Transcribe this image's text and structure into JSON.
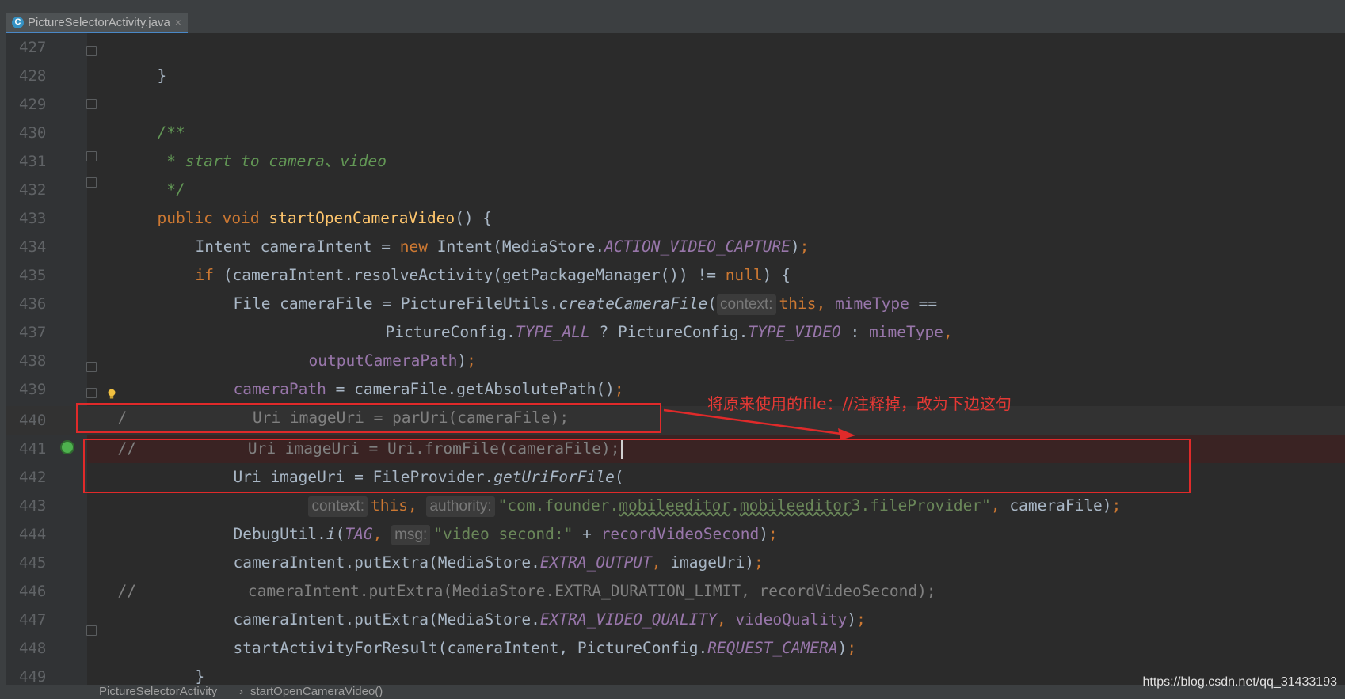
{
  "tab": {
    "icon": "class-c-icon",
    "label": "PictureSelectorActivity.java",
    "close": "×"
  },
  "annotation": {
    "text": "将原来使用的file：//注释掉，改为下边这句"
  },
  "breadcrumb": {
    "class_name": "PictureSelectorActivity",
    "separator": "›",
    "method_name": "startOpenCameraVideo()"
  },
  "watermark": "https://blog.csdn.net/qq_31433193",
  "lines": [
    {
      "num": "427"
    },
    {
      "num": "428"
    },
    {
      "num": "429"
    },
    {
      "num": "430"
    },
    {
      "num": "431"
    },
    {
      "num": "432"
    },
    {
      "num": "433"
    },
    {
      "num": "434"
    },
    {
      "num": "435"
    },
    {
      "num": "436"
    },
    {
      "num": "437"
    },
    {
      "num": "438"
    },
    {
      "num": "439"
    },
    {
      "num": "440"
    },
    {
      "num": "441"
    },
    {
      "num": "442"
    },
    {
      "num": "443"
    },
    {
      "num": "444"
    },
    {
      "num": "445"
    },
    {
      "num": "446"
    },
    {
      "num": "447"
    },
    {
      "num": "448"
    },
    {
      "num": "449"
    }
  ],
  "code": {
    "l427": "}",
    "l429": "/**",
    "l430": " * start to camera、video",
    "l431": " */",
    "l432_kw": "public void ",
    "l432_fn": "startOpenCameraVideo",
    "l432_rest": "() {",
    "l433_a": "Intent cameraIntent = ",
    "l433_kw": "new ",
    "l433_b": "Intent(MediaStore.",
    "l433_st": "ACTION_VIDEO_CAPTURE",
    "l433_c": ")",
    "l433_semi": ";",
    "l434_kw": "if ",
    "l434_a": "(cameraIntent.resolveActivity(getPackageManager()) != ",
    "l434_kw2": "null",
    "l434_b": ") {",
    "l435_a": "File cameraFile = PictureFileUtils.",
    "l435_it": "createCameraFile",
    "l435_b": "(",
    "l435_hint": "context:",
    "l435_kw": "this, ",
    "l435_fld": "mimeType",
    "l435_c": " ==",
    "l436_a": "PictureConfig.",
    "l436_st": "TYPE_ALL",
    "l436_b": " ? PictureConfig.",
    "l436_st2": "TYPE_VIDEO",
    "l436_c": " : ",
    "l436_fld": "mimeType",
    "l436_comma": ",",
    "l437_fld": "outputCameraPath",
    "l437_a": ")",
    "l437_semi": ";",
    "l438_fld": "cameraPath",
    "l438_a": " = cameraFile.getAbsolutePath()",
    "l438_semi": ";",
    "l439_comment_slash": "/",
    "l439_code": "  Uri imageUri = parUri(cameraFile);",
    "l440_comment": "//",
    "l440_code": "            Uri imageUri = Uri.fromFile(cameraFile);",
    "l441_a": "Uri imageUri = FileProvider.",
    "l441_it": "getUriForFile",
    "l441_b": "(",
    "l442_hint1": "context:",
    "l442_kw": "this, ",
    "l442_hint2": "authority:",
    "l442_str1": "\"com.founder.",
    "l442_str_w1": "mobileeditor",
    "l442_str2": ".",
    "l442_str_w2": "mobileeditor",
    "l442_str3": "3.fileProvider\"",
    "l442_comma": ", ",
    "l442_rest": "cameraFile)",
    "l442_semi": ";",
    "l443_a": "DebugUtil.",
    "l443_it": "i",
    "l443_b": "(",
    "l443_st": "TAG",
    "l443_comma": ", ",
    "l443_hint": "msg:",
    "l443_str": "\"video second:\"",
    "l443_c": " + ",
    "l443_fld": "recordVideoSecond",
    "l443_d": ")",
    "l443_semi": ";",
    "l444_a": "cameraIntent.putExtra(MediaStore.",
    "l444_st": "EXTRA_OUTPUT",
    "l444_comma": ", ",
    "l444_b": "imageUri)",
    "l444_semi": ";",
    "l445_comment": "//",
    "l445_code": "            cameraIntent.putExtra(MediaStore.EXTRA_DURATION_LIMIT, recordVideoSecond);",
    "l446_a": "cameraIntent.putExtra(MediaStore.",
    "l446_st": "EXTRA_VIDEO_QUALITY",
    "l446_comma": ", ",
    "l446_fld": "videoQuality",
    "l446_b": ")",
    "l446_semi": ";",
    "l447_a": "startActivityForResult(cameraIntent, PictureConfig.",
    "l447_st": "REQUEST_CAMERA",
    "l447_b": ")",
    "l447_semi": ";",
    "l448": "}",
    "l449": "}"
  }
}
